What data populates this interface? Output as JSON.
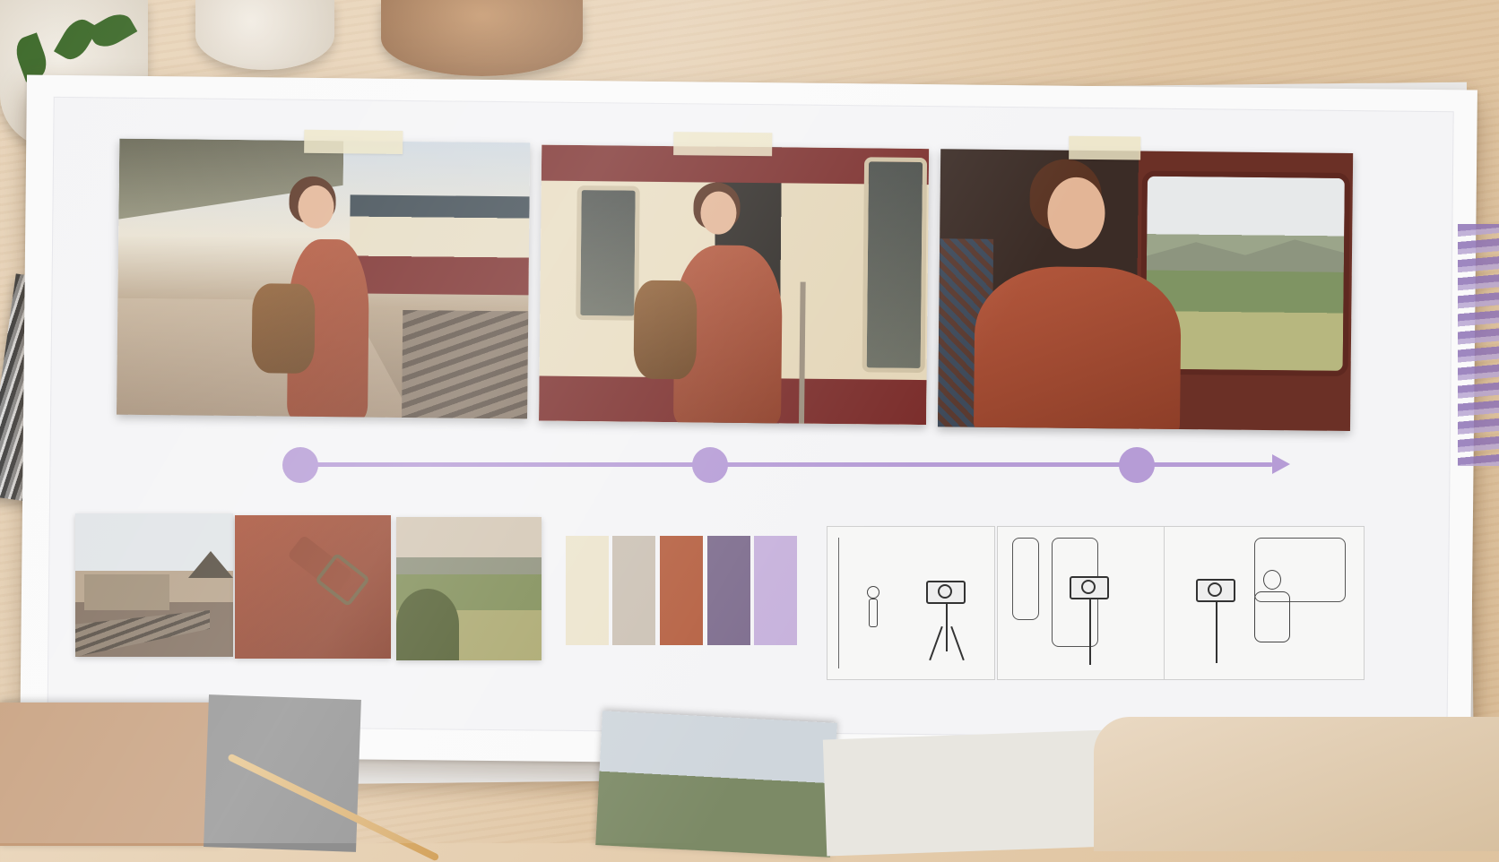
{
  "scene": {
    "board_frames": [
      {
        "name": "platform-shot"
      },
      {
        "name": "boarding-shot"
      },
      {
        "name": "window-shot"
      }
    ],
    "timeline": {
      "accent": "#b69cd6",
      "nodes": 3
    },
    "palette": [
      "#ece4cc",
      "#cbc1b4",
      "#b55f40",
      "#7e6d8e",
      "#c7b2dc"
    ],
    "references": [
      "station-reference",
      "coat-buckle-reference",
      "landscape-reference"
    ],
    "storyboards": [
      "sketch-platform",
      "sketch-door",
      "sketch-seat"
    ]
  }
}
